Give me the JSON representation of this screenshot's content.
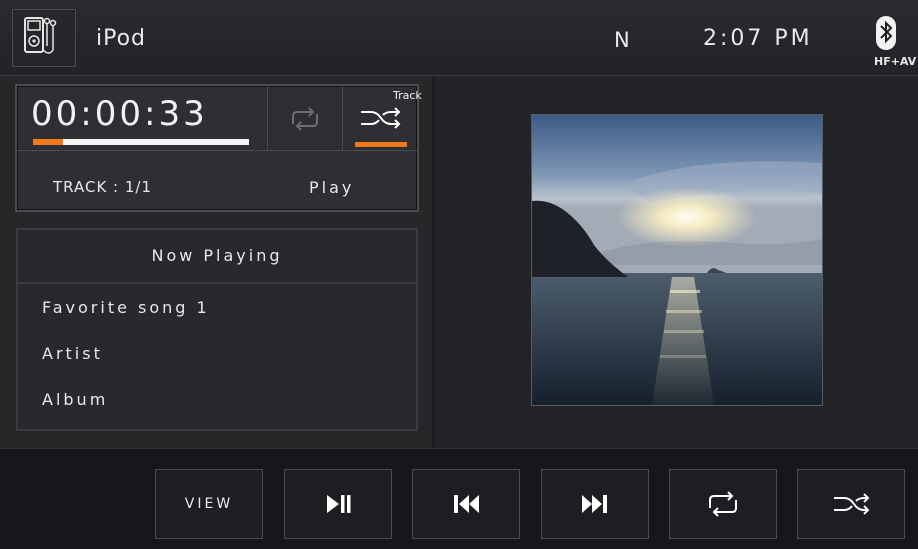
{
  "header": {
    "app_title": "iPod",
    "band": "N",
    "clock": "2:07 PM",
    "bluetooth_label": "HF+AV"
  },
  "status": {
    "elapsed": "00:00:33",
    "progress": 0.14,
    "shuffle_mode": "Track",
    "track": "TRACK : 1/1",
    "play_state": "Play"
  },
  "now_playing": {
    "title": "Now Playing",
    "song": "Favorite song 1",
    "artist": "Artist",
    "album": "Album"
  },
  "controls": {
    "view_label": "VIEW"
  },
  "icons": {
    "ipod": "ipod-icon",
    "bluetooth": "bluetooth-icon",
    "repeat": "repeat-icon",
    "shuffle": "shuffle-icon",
    "play_pause": "play-pause-icon",
    "previous": "previous-track-icon",
    "next": "next-track-icon"
  },
  "colors": {
    "accent": "#f07a1a",
    "background": "#1c1d20",
    "text": "#e9e9e9"
  }
}
